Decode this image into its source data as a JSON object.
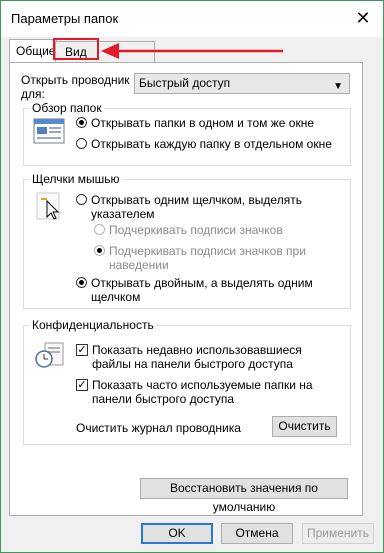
{
  "window": {
    "title": "Параметры папок",
    "close_glyph": "✕"
  },
  "tabs": [
    {
      "label": "Общие"
    },
    {
      "label": "Вид"
    }
  ],
  "general": {
    "open_explorer_label": "Открыть проводник для:",
    "open_explorer_value": "Быстрый доступ",
    "browse_group": {
      "title": "Обзор папок",
      "options": [
        {
          "label": "Открывать папки в одном и том же окне",
          "checked": true
        },
        {
          "label": "Открывать каждую папку в отдельном окне",
          "checked": false
        }
      ]
    },
    "clicks_group": {
      "title": "Щелчки мышью",
      "single_click": "Открывать одним щелчком, выделять указателем",
      "underline_always": "Подчеркивать подписи значков",
      "underline_hover": "Подчеркивать подписи значков при наведении",
      "double_click": "Открывать двойным, а выделять одним щелчком"
    },
    "privacy_group": {
      "title": "Конфиденциальность",
      "show_recent": "Показать недавно использовавшиеся файлы на панели быстрого доступа",
      "show_frequent": "Показать часто используемые папки на панели быстрого доступа",
      "clear_label": "Очистить журнал проводника",
      "clear_button": "Очистить"
    },
    "restore_defaults": "Восстановить значения по умолчанию"
  },
  "footer": {
    "ok": "OK",
    "cancel": "Отмена",
    "apply": "Применить"
  },
  "colors": {
    "highlight": "#e21b2a",
    "accent": "#2b78d4"
  }
}
